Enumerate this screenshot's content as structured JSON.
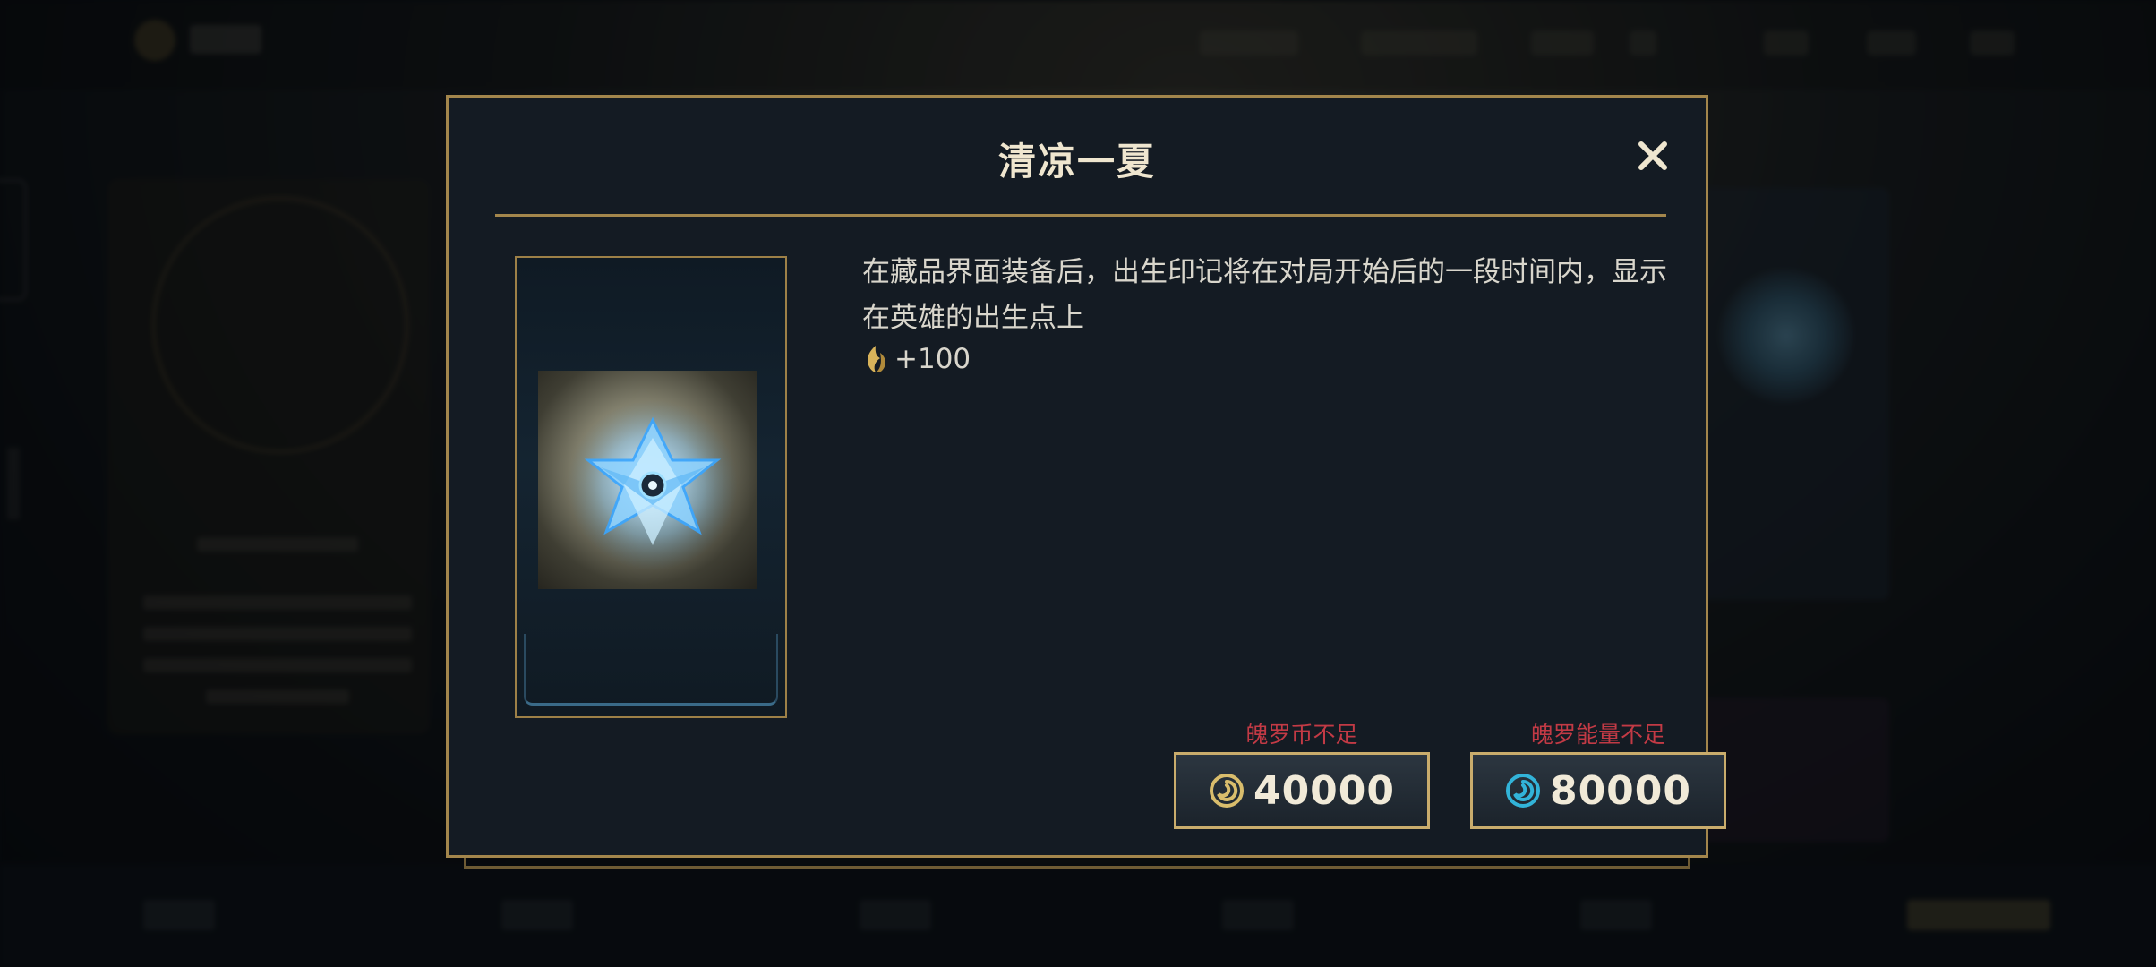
{
  "modal": {
    "title": "清凉一夏",
    "description": "在藏品界面装备后，出生印记将在对局开始后的一段时间内，显示在英雄的出生点上",
    "bonus": "+100",
    "purchase": [
      {
        "warning": "魄罗币不足",
        "price": "40000",
        "currency_icon": "gold-swirl-coin-icon",
        "color": "#d9bd6c"
      },
      {
        "warning": "魄罗能量不足",
        "price": "80000",
        "currency_icon": "blue-swirl-energy-icon",
        "color": "#32b3d8"
      }
    ]
  },
  "colors": {
    "accent_gold": "#a3864c",
    "warning_red": "#c23a45",
    "panel": "#141b23"
  }
}
